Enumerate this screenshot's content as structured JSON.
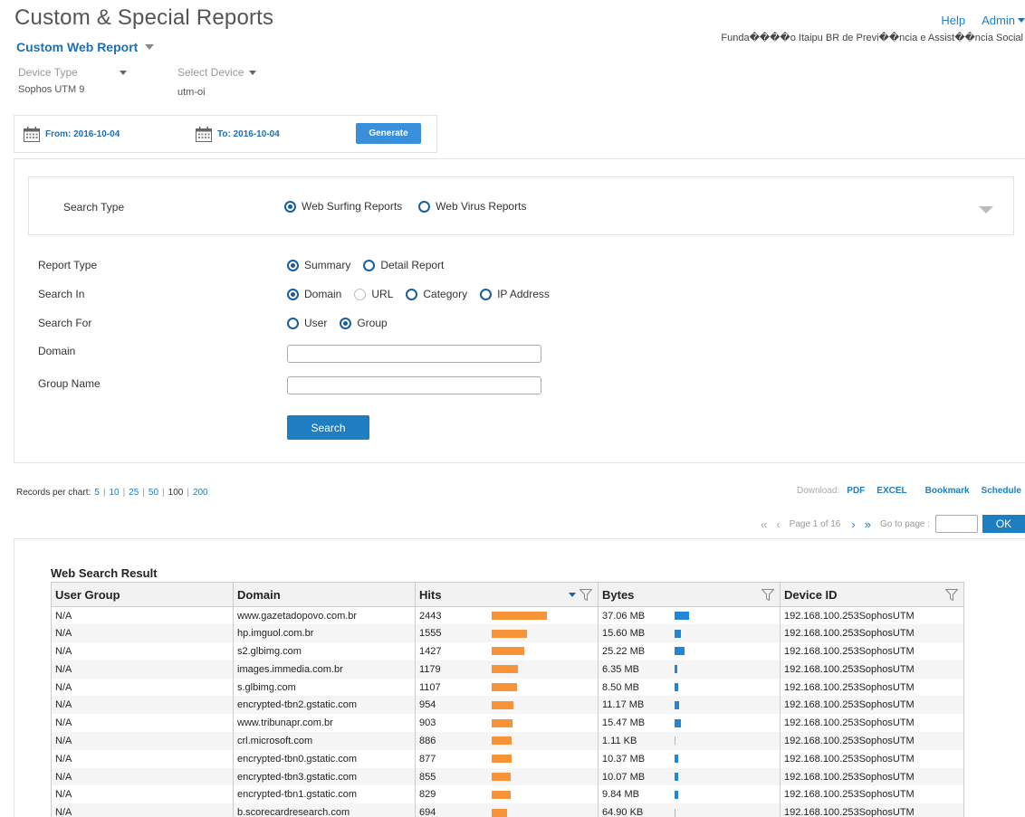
{
  "header": {
    "title": "Custom & Special Reports",
    "report_selector": "Custom Web Report",
    "help": "Help",
    "admin": "Admin",
    "org_name": "Funda����o Itaipu BR de Previ��ncia e Assist��ncia Social"
  },
  "device": {
    "type_label": "Device Type",
    "type_value": "Sophos UTM 9",
    "select_label": "Select Device",
    "select_value": "utm-oi"
  },
  "dates": {
    "from": "From: 2016-10-04",
    "to": "To: 2016-10-04",
    "generate": "Generate"
  },
  "search": {
    "search_type_label": "Search Type",
    "search_type_options": [
      "Web Surfing Reports",
      "Web Virus Reports"
    ],
    "report_type_label": "Report Type",
    "report_type_options": [
      "Summary",
      "Detail Report"
    ],
    "search_in_label": "Search In",
    "search_in_options": [
      "Domain",
      "URL",
      "Category",
      "IP Address"
    ],
    "search_for_label": "Search For",
    "search_for_options": [
      "User",
      "Group"
    ],
    "domain_label": "Domain",
    "domain_value": "",
    "group_label": "Group Name",
    "group_value": "",
    "button": "Search"
  },
  "records": {
    "label": "Records per chart:",
    "options": [
      "5",
      "10",
      "25",
      "50",
      "100",
      "200"
    ],
    "active": "100"
  },
  "download": {
    "label": "Download:",
    "pdf": "PDF",
    "excel": "EXCEL",
    "bookmark": "Bookmark",
    "schedule": "Schedule"
  },
  "pager": {
    "page_text": "Page 1 of 16",
    "goto_label": "Go to page :",
    "goto_value": "",
    "ok": "OK"
  },
  "results": {
    "title": "Web Search Result",
    "columns": [
      "User Group",
      "Domain",
      "Hits",
      "Bytes",
      "Device ID"
    ],
    "max_hits": 2443,
    "max_bytes_mb": 37.06,
    "rows": [
      {
        "group": "N/A",
        "domain": "www.gazetadopovo.com.br",
        "hits": 2443,
        "hits_text": "2443",
        "bytes": "37.06 MB",
        "bytes_mb": 37.06,
        "device": "192.168.100.253SophosUTM"
      },
      {
        "group": "N/A",
        "domain": "hp.imguol.com.br",
        "hits": 1555,
        "hits_text": "1555",
        "bytes": "15.60 MB",
        "bytes_mb": 15.6,
        "device": "192.168.100.253SophosUTM"
      },
      {
        "group": "N/A",
        "domain": "s2.glbimg.com",
        "hits": 1427,
        "hits_text": "1427",
        "bytes": "25.22 MB",
        "bytes_mb": 25.22,
        "device": "192.168.100.253SophosUTM"
      },
      {
        "group": "N/A",
        "domain": "images.immedia.com.br",
        "hits": 1179,
        "hits_text": "1179",
        "bytes": "6.35 MB",
        "bytes_mb": 6.35,
        "device": "192.168.100.253SophosUTM"
      },
      {
        "group": "N/A",
        "domain": "s.glbimg.com",
        "hits": 1107,
        "hits_text": "1107",
        "bytes": "8.50 MB",
        "bytes_mb": 8.5,
        "device": "192.168.100.253SophosUTM"
      },
      {
        "group": "N/A",
        "domain": "encrypted-tbn2.gstatic.com",
        "hits": 954,
        "hits_text": "954",
        "bytes": "11.17 MB",
        "bytes_mb": 11.17,
        "device": "192.168.100.253SophosUTM"
      },
      {
        "group": "N/A",
        "domain": "www.tribunapr.com.br",
        "hits": 903,
        "hits_text": "903",
        "bytes": "15.47 MB",
        "bytes_mb": 15.47,
        "device": "192.168.100.253SophosUTM"
      },
      {
        "group": "N/A",
        "domain": "crl.microsoft.com",
        "hits": 886,
        "hits_text": "886",
        "bytes": "1.11 KB",
        "bytes_mb": 0.001,
        "device": "192.168.100.253SophosUTM"
      },
      {
        "group": "N/A",
        "domain": "encrypted-tbn0.gstatic.com",
        "hits": 877,
        "hits_text": "877",
        "bytes": "10.37 MB",
        "bytes_mb": 10.37,
        "device": "192.168.100.253SophosUTM"
      },
      {
        "group": "N/A",
        "domain": "encrypted-tbn3.gstatic.com",
        "hits": 855,
        "hits_text": "855",
        "bytes": "10.07 MB",
        "bytes_mb": 10.07,
        "device": "192.168.100.253SophosUTM"
      },
      {
        "group": "N/A",
        "domain": "encrypted-tbn1.gstatic.com",
        "hits": 829,
        "hits_text": "829",
        "bytes": "9.84 MB",
        "bytes_mb": 9.84,
        "device": "192.168.100.253SophosUTM"
      },
      {
        "group": "N/A",
        "domain": "b.scorecardresearch.com",
        "hits": 694,
        "hits_text": "694",
        "bytes": "64.90 KB",
        "bytes_mb": 0.065,
        "device": "192.168.100.253SophosUTM"
      }
    ]
  },
  "colors": {
    "accent": "#1f7dc1",
    "hits_bar": "#f7943a",
    "bytes_bar": "#1f86d8"
  }
}
